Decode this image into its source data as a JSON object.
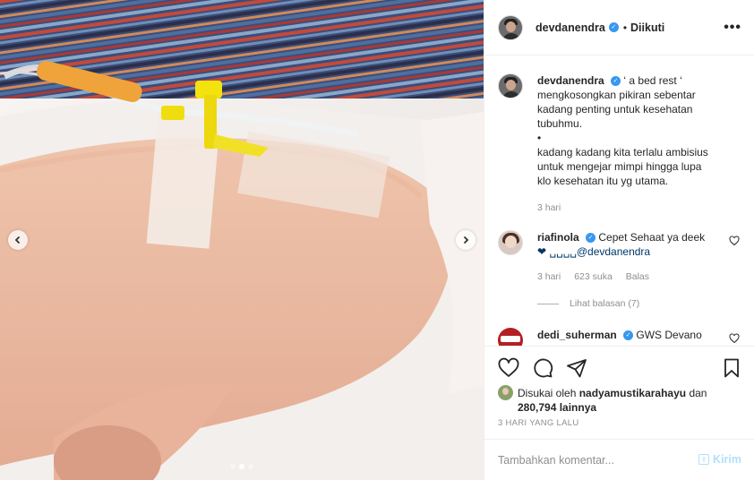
{
  "photo": {
    "dots": [
      {
        "active": false
      },
      {
        "active": true
      },
      {
        "active": false
      }
    ]
  },
  "header": {
    "username": "devdanendra",
    "separator": "•",
    "follow_label": "Diikuti",
    "more_label": "•••"
  },
  "caption": {
    "username": "devdanendra",
    "lines": [
      "‘ a bed rest ‘",
      "mengkosongkan pikiran sebentar",
      "kadang penting untuk kesehatan",
      "tubuhmu.",
      "•",
      "kadang kadang kita terlalu ambisius",
      "untuk mengejar mimpi hingga lupa",
      "klo kesehatan itu yg utama."
    ],
    "time": "3 hari"
  },
  "comments": [
    {
      "username": "riafinola",
      "text": "Cepet Sehaat ya deek",
      "text2": "❤ ␣␣␣␣@devdanendra",
      "time": "3 hari",
      "likes": "623 suka",
      "reply": "Balas",
      "view_replies": "Lihat balasan (7)"
    },
    {
      "username": "dedi_suherman",
      "text": "GWS Devano"
    }
  ],
  "likes": {
    "prefix": "Disukai oleh",
    "liker": "nadyamustikarahayu",
    "connector": "dan",
    "count": "280,794 lainnya"
  },
  "post_time": "3 HARI YANG LALU",
  "add_comment": {
    "placeholder": "Tambahkan komentar...",
    "post_label": "Kirim"
  }
}
